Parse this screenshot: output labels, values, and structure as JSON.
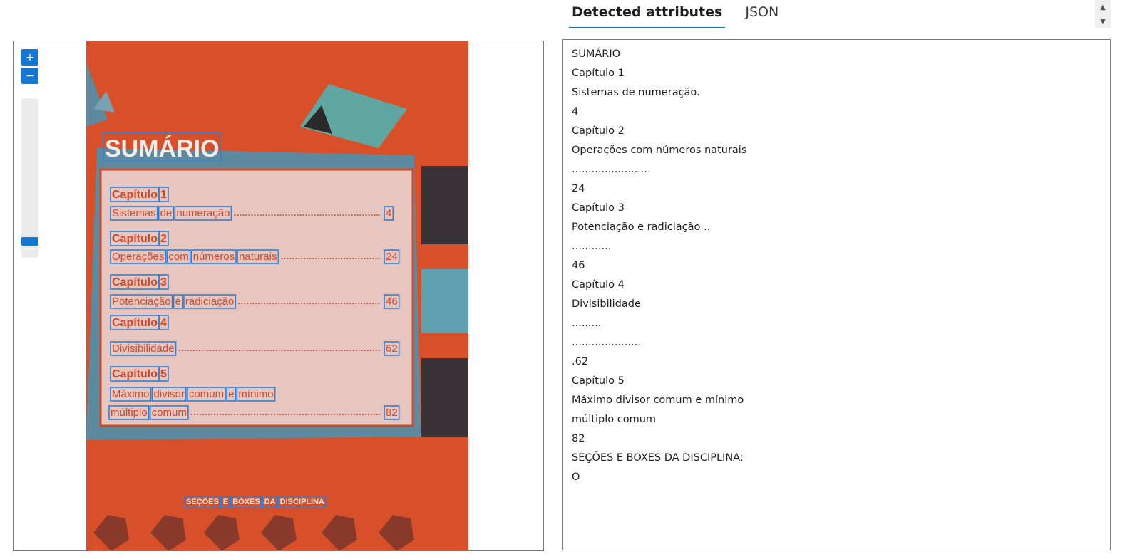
{
  "tabs": [
    {
      "label": "Detected attributes",
      "active": true
    },
    {
      "label": "JSON",
      "active": false
    }
  ],
  "viewer": {
    "zoom_in_icon": "plus-icon",
    "zoom_out_icon": "minus-icon",
    "zoom_level": 0.08,
    "document": {
      "title": "SUMÁRIO",
      "chapters": [
        {
          "chapter": "Capítulo",
          "number": "1",
          "name_words": [
            "Sistemas",
            "de",
            "numeração"
          ],
          "page": "4"
        },
        {
          "chapter": "Capítulo",
          "number": "2",
          "name_words": [
            "Operações",
            "com",
            "números",
            "naturais"
          ],
          "page": "24"
        },
        {
          "chapter": "Capítulo",
          "number": "3",
          "name_words": [
            "Potenciação",
            "e",
            "radiciação"
          ],
          "page": "46"
        },
        {
          "chapter": "Capítulo",
          "number": "4",
          "name_words": [
            "Divisibilidade"
          ],
          "page": "62"
        },
        {
          "chapter": "Capítulo",
          "number": "5",
          "name_words": [
            "Máximo",
            "divisor",
            "comum",
            "e",
            "mínimo"
          ],
          "name_words_2": [
            "múltiplo",
            "comum"
          ],
          "page": "82"
        }
      ],
      "sections_label": [
        "SEÇÕES",
        "E",
        "BOXES",
        "DA",
        "DISCIPLINA"
      ]
    }
  },
  "results": {
    "lines": [
      "SUMÁRIO",
      "Capítulo 1",
      "Sistemas de numeração.",
      "4",
      "Capítulo 2",
      "Operações com números naturais",
      "........................",
      "24",
      "Capítulo 3",
      "Potenciação e radiciação ..",
      "............",
      "46",
      "Capítulo 4",
      "Divisibilidade",
      ".........",
      ".....................",
      ".62",
      "Capítulo 5",
      "Máximo divisor comum e mínimo",
      "múltiplo comum",
      "82",
      "SEÇÕES E BOXES DA DISCIPLINA:",
      "O"
    ]
  },
  "colors": {
    "accent": "#1478d4",
    "page_orange": "#d8502a",
    "panel_blue": "#5e8aa0",
    "panel_pink": "#e8c6c0",
    "box_blue": "#2f7fd6"
  }
}
